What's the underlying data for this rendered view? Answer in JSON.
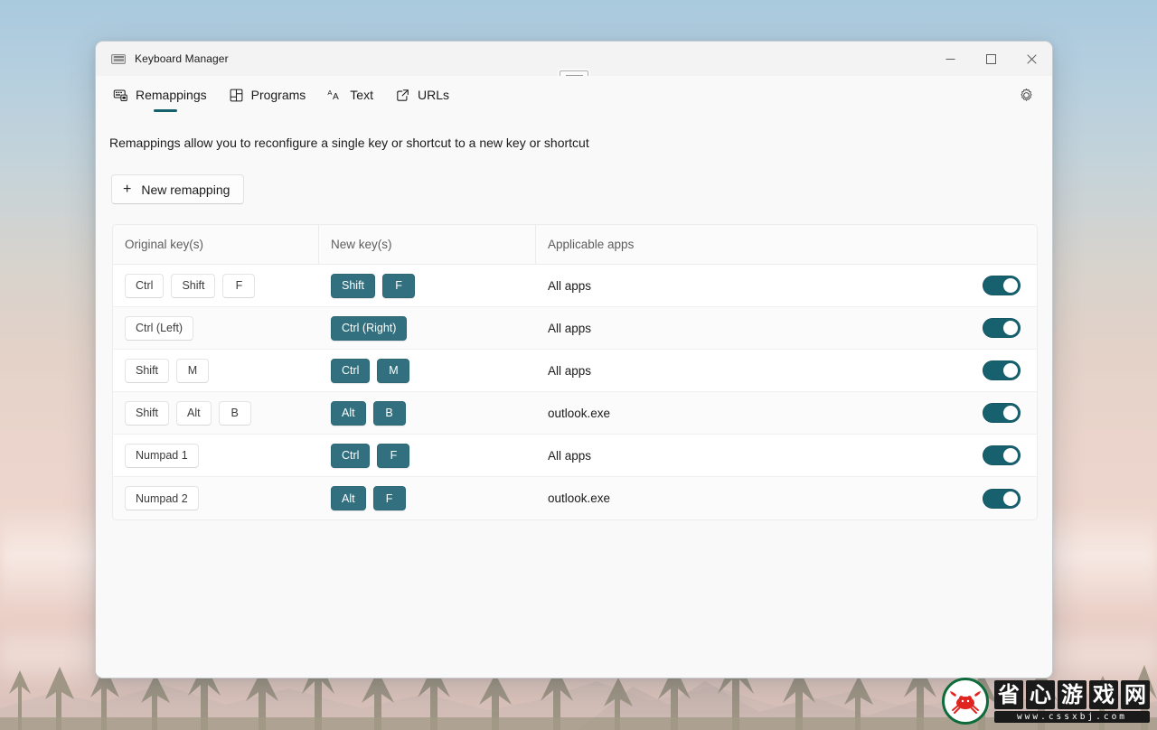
{
  "window": {
    "title": "Keyboard Manager",
    "app_icon": "keyboard-icon",
    "controls": {
      "minimize": "Minimize",
      "maximize": "Maximize",
      "close": "Close"
    }
  },
  "tabs": [
    {
      "label": "Remappings",
      "icon": "keyboard-remap-icon",
      "active": true
    },
    {
      "label": "Programs",
      "icon": "apps-grid-icon",
      "active": false
    },
    {
      "label": "Text",
      "icon": "font-size-icon",
      "active": false
    },
    {
      "label": "URLs",
      "icon": "open-link-icon",
      "active": false
    }
  ],
  "settings_button": {
    "icon": "gear-icon",
    "label": "Settings"
  },
  "main": {
    "description": "Remappings allow you to reconfigure a single key or shortcut to a new key or shortcut",
    "new_remapping_label": "New remapping",
    "new_remapping_icon": "plus-icon"
  },
  "table": {
    "columns": [
      "Original key(s)",
      "New key(s)",
      "Applicable apps"
    ],
    "rows": [
      {
        "original": [
          "Ctrl",
          "Shift",
          "F"
        ],
        "new": [
          "Shift",
          "F"
        ],
        "apps": "All apps",
        "enabled": true
      },
      {
        "original": [
          "Ctrl (Left)"
        ],
        "new": [
          "Ctrl (Right)"
        ],
        "apps": "All apps",
        "enabled": true
      },
      {
        "original": [
          "Shift",
          "M"
        ],
        "new": [
          "Ctrl",
          "M"
        ],
        "apps": "All apps",
        "enabled": true
      },
      {
        "original": [
          "Shift",
          "Alt",
          "B"
        ],
        "new": [
          "Alt",
          "B"
        ],
        "apps": "outlook.exe",
        "enabled": true
      },
      {
        "original": [
          "Numpad 1"
        ],
        "new": [
          "Ctrl",
          "F"
        ],
        "apps": "All apps",
        "enabled": true
      },
      {
        "original": [
          "Numpad 2"
        ],
        "new": [
          "Alt",
          "F"
        ],
        "apps": "outlook.exe",
        "enabled": true
      }
    ]
  },
  "watermark": {
    "characters": [
      "省",
      "心",
      "游",
      "戏",
      "网"
    ],
    "url": "www.cssxbj.com",
    "logo": "crab-icon"
  },
  "colors": {
    "accent_teal": "#33707f",
    "toggle_on": "#17616e",
    "tab_underline": "#14616c",
    "window_bg": "#f9f9f9",
    "table_bg": "#ffffff"
  }
}
